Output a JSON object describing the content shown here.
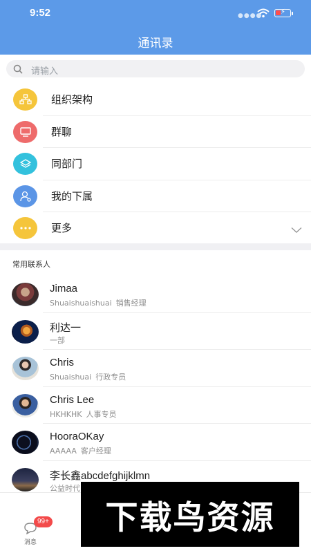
{
  "status": {
    "time": "9:52"
  },
  "header": {
    "title": "通讯录"
  },
  "search": {
    "placeholder": "请输入"
  },
  "menu": [
    {
      "label": "组织架构",
      "icon": "org-chart-icon",
      "color": "#f5c53b"
    },
    {
      "label": "群聊",
      "icon": "group-chat-icon",
      "color": "#ee6b6b"
    },
    {
      "label": "同部门",
      "icon": "layers-icon",
      "color": "#33c1dd"
    },
    {
      "label": "我的下属",
      "icon": "subordinate-icon",
      "color": "#5b95e6"
    },
    {
      "label": "更多",
      "icon": "more-icon",
      "color": "#f5c53b"
    }
  ],
  "section_title": "常用联系人",
  "contacts": [
    {
      "name": "Jimaa",
      "sub": "Shuaishuaishuai",
      "role": "销售经理"
    },
    {
      "name": "利达一",
      "sub": "一部",
      "role": ""
    },
    {
      "name": "Chris",
      "sub": "Shuaishuai",
      "role": "行政专员"
    },
    {
      "name": "Chris Lee",
      "sub": "HKHKHK",
      "role": "人事专员"
    },
    {
      "name": "HooraOKay",
      "sub": "AAAAA",
      "role": "客户经理"
    },
    {
      "name": "李长鑫abcdefghijklmn",
      "sub": "公益时代",
      "role": ""
    }
  ],
  "tabbar": {
    "message_label": "消息",
    "badge": "99+"
  },
  "watermark": "下载鸟资源",
  "colors": {
    "header": "#5c9ae8",
    "badge": "#f34a4a"
  }
}
